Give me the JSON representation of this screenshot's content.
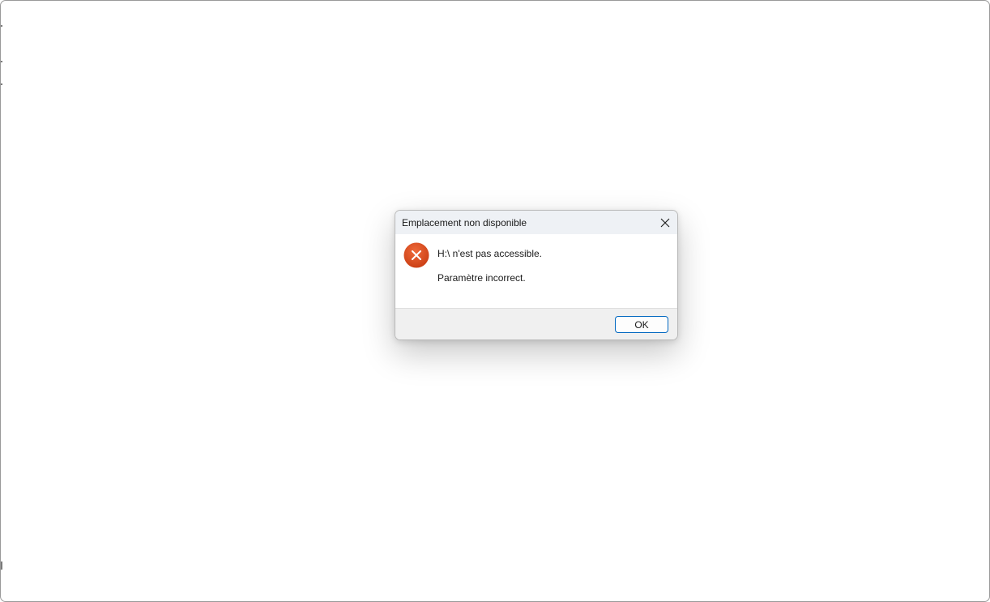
{
  "dialog": {
    "title": "Emplacement non disponible",
    "message": "H:\\ n'est pas accessible.",
    "detail": "Paramètre incorrect.",
    "icon": "error-icon",
    "ok_label": "OK",
    "close_icon": "close-icon"
  },
  "colors": {
    "titlebar_bg": "#eef1f5",
    "footer_bg": "#f0f0f0",
    "error_icon": "#d9461b",
    "button_border": "#0067c0"
  }
}
